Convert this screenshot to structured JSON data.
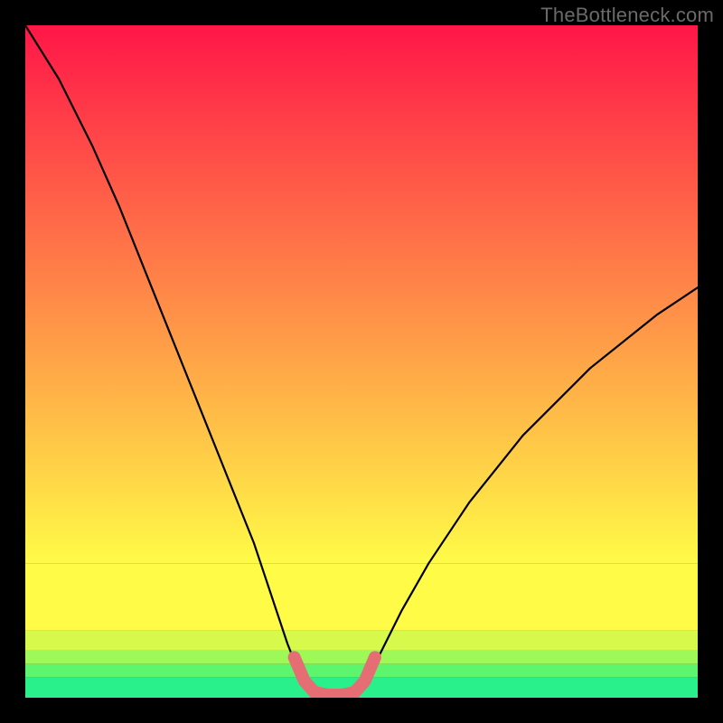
{
  "watermark": "TheBottleneck.com",
  "chart_data": {
    "type": "line",
    "title": "",
    "xlabel": "",
    "ylabel": "",
    "xlim": [
      0,
      100
    ],
    "ylim": [
      0,
      100
    ],
    "background_bands": [
      {
        "y0": 0,
        "y1": 3,
        "color": "#29f08a"
      },
      {
        "y0": 3,
        "y1": 5,
        "color": "#5cf56d"
      },
      {
        "y0": 5,
        "y1": 7,
        "color": "#9ef857"
      },
      {
        "y0": 7,
        "y1": 10,
        "color": "#d7f94b"
      },
      {
        "y0": 10,
        "y1": 20,
        "color": "#fffb47"
      },
      {
        "y0": 20,
        "y1": 100,
        "gradient": [
          "#fffb47",
          "#ff1648"
        ]
      }
    ],
    "series": [
      {
        "name": "curve",
        "type": "line",
        "stroke": "#000000",
        "x": [
          0,
          5,
          10,
          14,
          18,
          22,
          26,
          30,
          34,
          37,
          39,
          41,
          42,
          44,
          48,
          50,
          51,
          53,
          56,
          60,
          66,
          74,
          84,
          94,
          100
        ],
        "y": [
          100,
          92,
          82,
          73,
          63,
          53,
          43,
          33,
          23,
          14,
          8,
          3,
          1,
          0.5,
          0.5,
          1,
          3,
          7,
          13,
          20,
          29,
          39,
          49,
          57,
          61
        ]
      },
      {
        "name": "valley-marker",
        "type": "line",
        "stroke": "#e46e74",
        "stroke_width": 14,
        "x": [
          40,
          41.5,
          43,
          45,
          47,
          49,
          50.5,
          52
        ],
        "y": [
          6,
          2.5,
          0.8,
          0.4,
          0.4,
          0.8,
          2.5,
          6
        ]
      }
    ]
  }
}
